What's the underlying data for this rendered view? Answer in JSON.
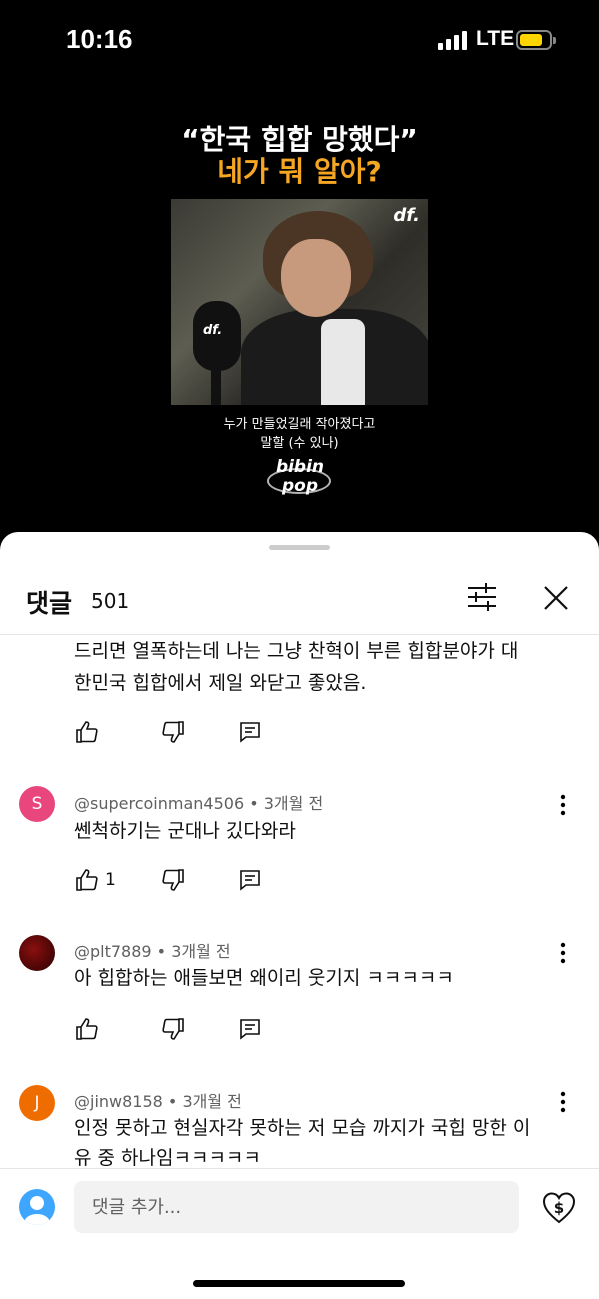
{
  "status": {
    "time": "10:16",
    "network": "LTE",
    "battery_color": "#ffd500"
  },
  "video": {
    "title_line1": "“한국 힙합 망했다”",
    "title_line2": "네가 뭐 알아?",
    "title_line2_color": "#f5a623",
    "thumb_logo": "df.",
    "mic_logo": "df.",
    "subtitle_line1": "누가 만들었길래 작아졌다고",
    "subtitle_line2": "말할 (수 있나)",
    "brand_line1": "bibin",
    "brand_line2": "pop"
  },
  "comments_sheet": {
    "title": "댓글",
    "count": "501",
    "icons": {
      "filter": "filter-icon",
      "close": "close-icon"
    },
    "comments": [
      {
        "text_line1": "드리면 열폭하는데 나는 그냥 찬혁이 부른 힙합분야가 대",
        "text_line2": "한민국 힙합에서 제일 와닫고 좋았음."
      },
      {
        "avatar_letter": "S",
        "avatar_color": "#e8467c",
        "author": "@supercoinman4506",
        "time": "3개월 전",
        "text": "쎈척하기는 군대나 깄다와라",
        "likes": "1"
      },
      {
        "avatar_color": "#5a0a0a",
        "author": "@plt7889",
        "time": "3개월 전",
        "text": "아 힙합하는 애들보면 왜이리 웃기지 ㅋㅋㅋㅋㅋ"
      },
      {
        "avatar_letter": "J",
        "avatar_color": "#ef6c00",
        "author": "@jinw8158",
        "time": "3개월 전",
        "text_line1": "인정 못하고 현실자각 못하는 저 모습 까지가 국힙 망한 이",
        "text_line2": "유 중 하나임ㅋㅋㅋㅋㅋ"
      }
    ],
    "input_placeholder": "댓글 추가...",
    "separator": " • "
  }
}
